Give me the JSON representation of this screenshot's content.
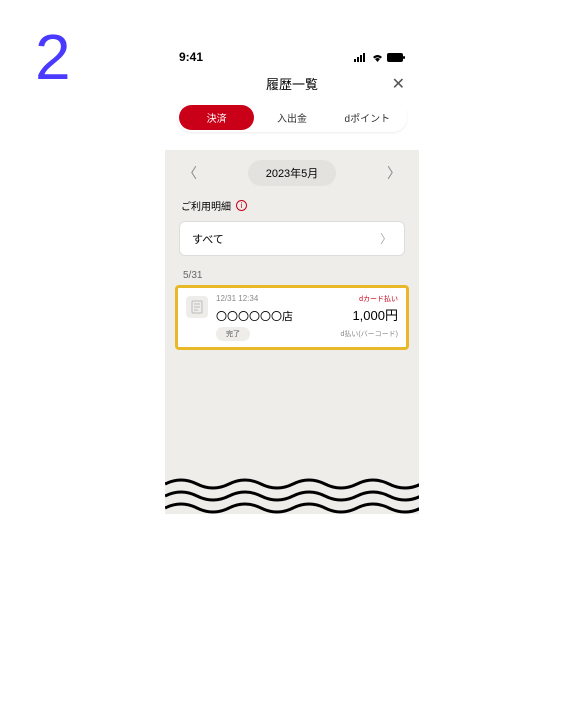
{
  "step": "2",
  "status": {
    "time": "9:41"
  },
  "header": {
    "title": "履歴一覧"
  },
  "tabs": {
    "payment": "決済",
    "deposit": "入出金",
    "dpoint": "dポイント"
  },
  "month_nav": {
    "label": "2023年5月"
  },
  "usage": {
    "label": "ご利用明細"
  },
  "filter": {
    "value": "すべて"
  },
  "date_group": "5/31",
  "txn": {
    "datetime": "12/31 12:34",
    "card_label": "dカード払い",
    "store": "〇〇〇〇〇〇店",
    "amount": "1,000円",
    "status": "完了",
    "method": "d払い(バーコード)"
  }
}
